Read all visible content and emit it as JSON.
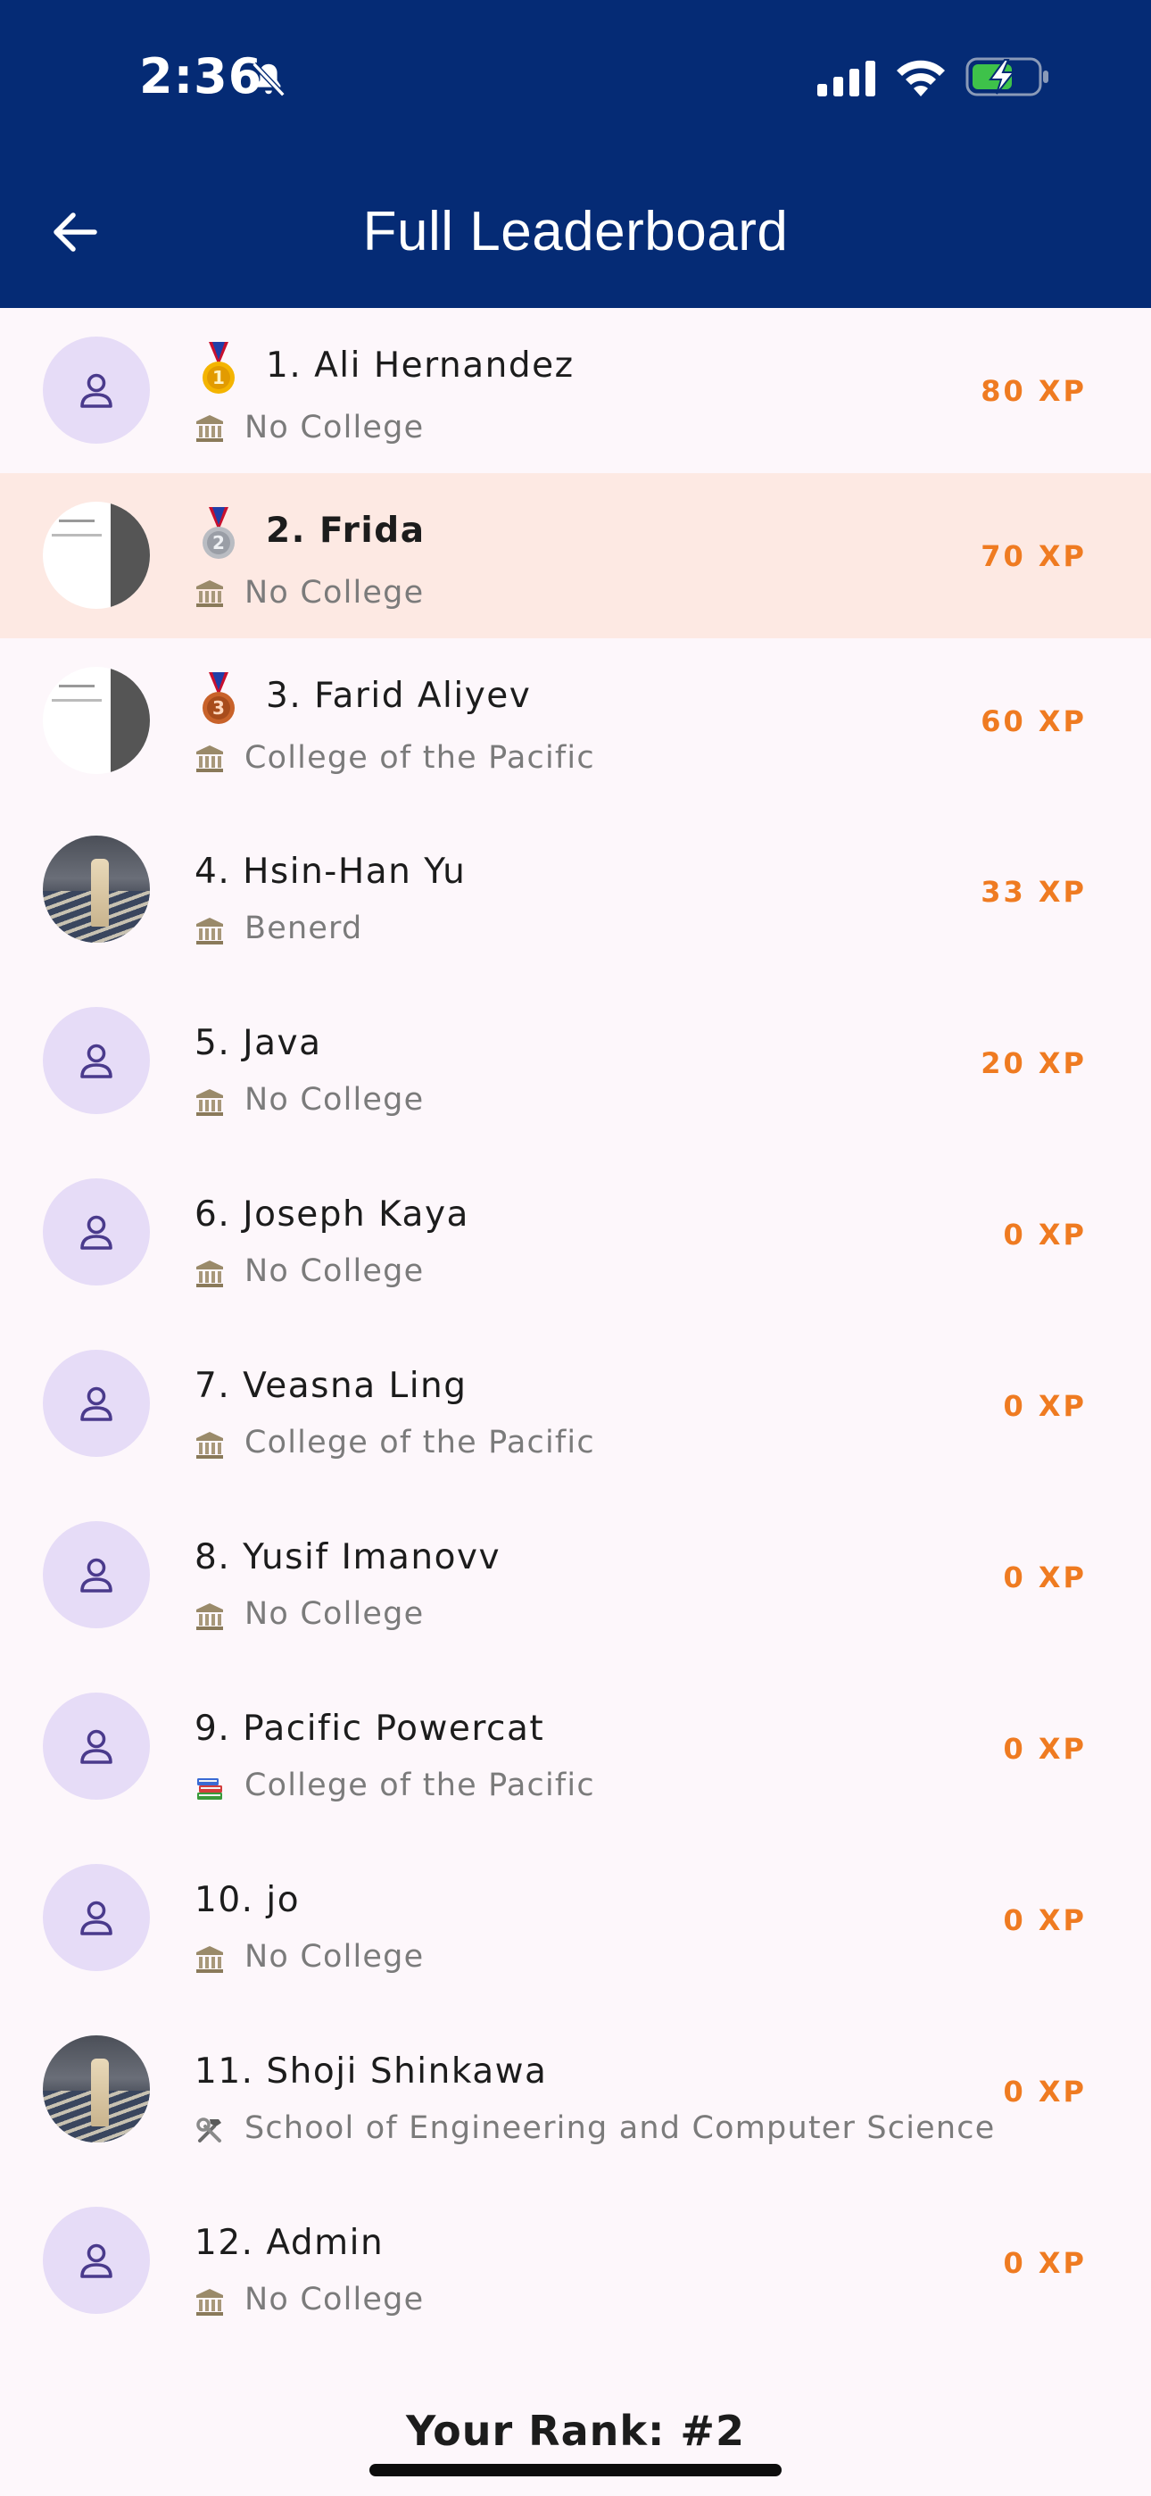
{
  "status_bar": {
    "time": "2:36",
    "icons": [
      "bell-slash-icon",
      "cellular-signal-icon",
      "wifi-icon",
      "battery-charging-icon"
    ]
  },
  "header": {
    "title": "Full Leaderboard",
    "back_icon": "arrow-left-icon",
    "background_color": "#052b75"
  },
  "colors": {
    "xp": "#ef7b21",
    "highlight_row": "#fde9e3",
    "avatar_placeholder": "#e6dcf7",
    "avatar_icon": "#4a3a8c"
  },
  "leaderboard": [
    {
      "rank_name": "1. Ali Hernandez",
      "college": "No College",
      "college_icon": "classical-building-icon",
      "xp": "80 XP",
      "medal": "gold-medal-icon",
      "avatar": "default-user-icon"
    },
    {
      "rank_name": "2. Frida",
      "college": "No College",
      "college_icon": "classical-building-icon",
      "xp": "70 XP",
      "medal": "silver-medal-icon",
      "avatar": "screenshot-avatar",
      "current_user": true
    },
    {
      "rank_name": "3. Farid Aliyev",
      "college": "College of the Pacific",
      "college_icon": "classical-building-icon",
      "xp": "60 XP",
      "medal": "bronze-medal-icon",
      "avatar": "screenshot-avatar"
    },
    {
      "rank_name": "4. Hsin-Han Yu",
      "college": "Benerd",
      "college_icon": "classical-building-icon",
      "xp": "33 XP",
      "avatar": "photo-avatar"
    },
    {
      "rank_name": "5. Java",
      "college": "No College",
      "college_icon": "classical-building-icon",
      "xp": "20 XP",
      "avatar": "default-user-icon"
    },
    {
      "rank_name": "6. Joseph Kaya",
      "college": "No College",
      "college_icon": "classical-building-icon",
      "xp": "0 XP",
      "avatar": "default-user-icon"
    },
    {
      "rank_name": "7. Veasna Ling",
      "college": "College of the Pacific",
      "college_icon": "classical-building-icon",
      "xp": "0 XP",
      "avatar": "default-user-icon"
    },
    {
      "rank_name": "8. Yusif Imanovv",
      "college": "No College",
      "college_icon": "classical-building-icon",
      "xp": "0 XP",
      "avatar": "default-user-icon"
    },
    {
      "rank_name": "9. Pacific Powercat",
      "college": "College of the Pacific",
      "college_icon": "books-icon",
      "xp": "0 XP",
      "avatar": "default-user-icon"
    },
    {
      "rank_name": "10. jo",
      "college": "No College",
      "college_icon": "classical-building-icon",
      "xp": "0 XP",
      "avatar": "default-user-icon"
    },
    {
      "rank_name": "11. Shoji Shinkawa",
      "college": "School of Engineering and Computer Science",
      "college_icon": "hammer-and-wrench-icon",
      "xp": "0 XP",
      "avatar": "photo-avatar"
    },
    {
      "rank_name": "12. Admin",
      "college": "No College",
      "college_icon": "classical-building-icon",
      "xp": "0 XP",
      "avatar": "default-user-icon"
    }
  ],
  "footer": {
    "your_rank": "Your Rank: #2"
  }
}
